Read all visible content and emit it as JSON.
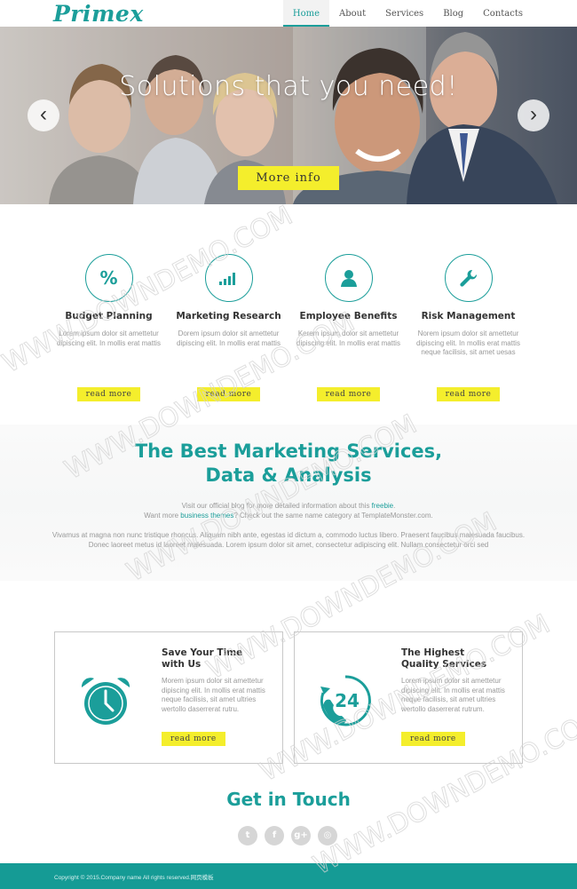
{
  "brand": {
    "logo": "Primex",
    "accent": "#1b9e9a",
    "button_yellow": "#f4ee2c"
  },
  "nav": {
    "items": [
      {
        "label": "Home",
        "active": true
      },
      {
        "label": "About"
      },
      {
        "label": "Services"
      },
      {
        "label": "Blog"
      },
      {
        "label": "Contacts"
      }
    ]
  },
  "hero": {
    "title": "Solutions that you need!",
    "button": "More info",
    "prev_icon": "chevron-left-icon",
    "next_icon": "chevron-right-icon"
  },
  "features": [
    {
      "icon": "percent-icon",
      "glyph": "%",
      "title": "Budget Planning",
      "text": "Lorem ipsum dolor sit amettetur dipiscing elit. In mollis erat mattis",
      "button": "read more"
    },
    {
      "icon": "bar-chart-icon",
      "title": "Marketing Research",
      "text": "Dorem ipsum dolor sit amettetur dipiscing elit. In mollis erat mattis",
      "button": "read more"
    },
    {
      "icon": "user-icon",
      "title": "Employee Benefits",
      "text": "Kerem ipsum dolor sit amettetur dipiscing elit. In mollis erat mattis",
      "button": "read more"
    },
    {
      "icon": "wrench-icon",
      "title": "Risk Management",
      "text": "Norem ipsum dolor sit amettetur dipiscing elit. In mollis erat mattis neque facilisis, sit amet uesas",
      "button": "read more"
    }
  ],
  "marketing": {
    "title_line1": "The Best Marketing Services,",
    "title_line2": "Data & Analysis",
    "line1_pre": "Visit our official blog for more detailed information about this ",
    "line1_link": "freebie",
    "line1_post": ".",
    "line2_pre": "Want more ",
    "line2_link": "business themes",
    "line2_post": "? Check out the same name category at TemplateMonster.com.",
    "paragraph": "Vivamus at magna non nunc tristique rhoncus. Aliquam nibh ante, egestas id dictum a, commodo luctus libero. Praesent faucibus malesuada faucibus. Donec laoreet metus id laoreet malesuada. Lorem ipsum dolor sit amet, consectetur adipiscing elit. Nullam consectetur orci sed"
  },
  "boxes": [
    {
      "icon": "alarm-clock-icon",
      "title_line1": "Save Your Time",
      "title_line2": "with Us",
      "text": "Morem ipsum dolor sit amettetur dipiscing elit. In mollis erat mattis neque facilisis, sit amet ultries wertollo daserrerat rutru.",
      "button": "read more"
    },
    {
      "icon": "phone-24-icon",
      "badge": "24",
      "title_line1": "The Highest",
      "title_line2": "Quality Services",
      "text": "Lorem ipsum dolor sit amettetur dipiscing elit. In mollis erat mattis neque facilisis, sit amet ultries wertollo daserrerat rutrum.",
      "button": "read more"
    }
  ],
  "contact": {
    "title": "Get in Touch",
    "socials": [
      {
        "name": "twitter-icon",
        "glyph": "t"
      },
      {
        "name": "facebook-icon",
        "glyph": "f"
      },
      {
        "name": "google-plus-icon",
        "glyph": "g+"
      },
      {
        "name": "instagram-icon",
        "glyph": "◎"
      }
    ]
  },
  "footer": {
    "copyright": "Copyright © 2015.Company name All rights reserved.网页模板"
  },
  "watermark": {
    "text": "WWW.DOWNDEMO.COM"
  }
}
